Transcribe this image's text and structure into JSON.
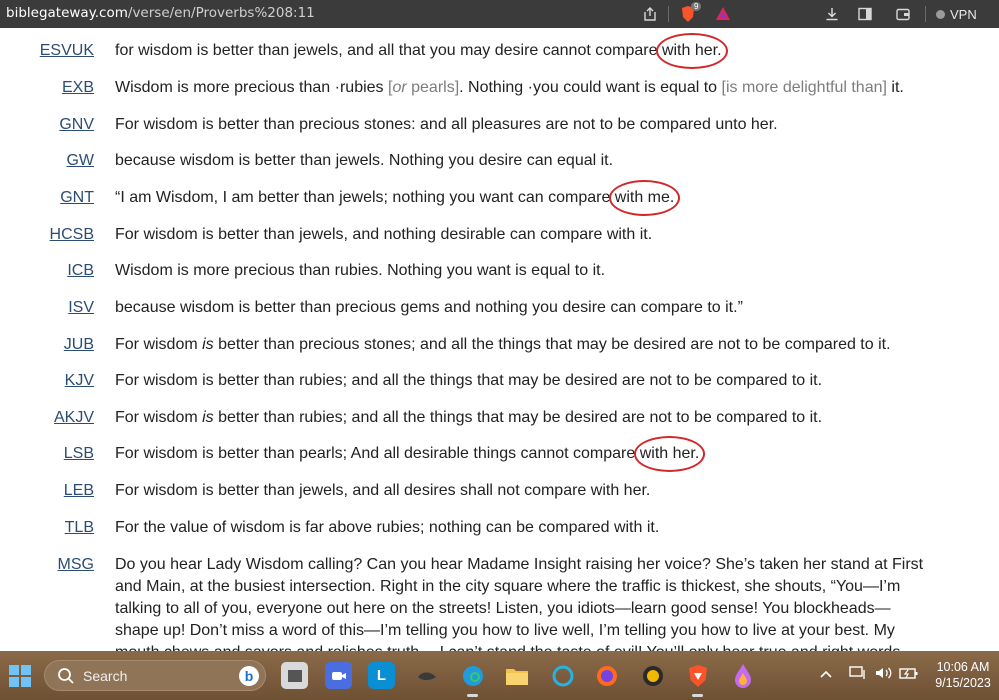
{
  "browser": {
    "url_host": "biblegateway.com",
    "url_path": "/verse/en/Proverbs%208:11",
    "vpn_label": "VPN",
    "brave_badge": "9",
    "icons": [
      "share-icon",
      "brave-shields-icon",
      "brave-rewards-icon",
      "download-icon",
      "sidebar-icon",
      "wallet-icon"
    ]
  },
  "verses": [
    {
      "abbr": "ESVUK",
      "pre": "for wisdom is better than jewels, and all that you may desire cannot compare ",
      "circled": "with her.",
      "post": ""
    },
    {
      "abbr": "EXB",
      "text_parts": [
        {
          "t": "Wisdom is more precious than ·rubies "
        },
        {
          "t": "[or pearls]",
          "note": true,
          "em": "or"
        },
        {
          "t": ". Nothing ·you could want is equal to "
        },
        {
          "t": "[is more delightful than]",
          "note": true
        },
        {
          "t": " it."
        }
      ]
    },
    {
      "abbr": "GNV",
      "text": "For wisdom is better than precious stones: and all pleasures are not to be compared unto her."
    },
    {
      "abbr": "GW",
      "text": "because wisdom is better than jewels. Nothing you desire can equal it."
    },
    {
      "abbr": "GNT",
      "pre": "“I am Wisdom, I am better than jewels; nothing you want can compare ",
      "circled": "with me.",
      "post": ""
    },
    {
      "abbr": "HCSB",
      "text": "For wisdom is better than jewels, and nothing desirable can compare with it."
    },
    {
      "abbr": "ICB",
      "text": "Wisdom is more precious than rubies. Nothing you want is equal to it."
    },
    {
      "abbr": "ISV",
      "text": "because wisdom is better than precious gems and nothing you desire can compare to it.”"
    },
    {
      "abbr": "JUB",
      "pre": "For wisdom ",
      "italic": "is",
      "post": " better than precious stones; and all the things that may be desired are not to be compared to it."
    },
    {
      "abbr": "KJV",
      "text": "For wisdom is better than rubies; and all the things that may be desired are not to be compared to it."
    },
    {
      "abbr": "AKJV",
      "pre": "For wisdom ",
      "italic": "is",
      "post": " better than rubies; and all the things that may be desired are not to be compared to it."
    },
    {
      "abbr": "LSB",
      "pre": "For wisdom is better than pearls; And all desirable things cannot compare ",
      "circled": "with her.",
      "post": ""
    },
    {
      "abbr": "LEB",
      "text": "For wisdom is better than jewels, and all desires shall not compare with her."
    },
    {
      "abbr": "TLB",
      "text": "For the value of wisdom is far above rubies; nothing can be compared with it."
    },
    {
      "abbr": "MSG",
      "text": "Do you hear Lady Wisdom calling? Can you hear Madame Insight raising her voice? She’s taken her stand at First and Main, at the busiest intersection. Right in the city square where the traffic is thickest, she shouts, “You—I’m talking to all of you, everyone out here on the streets! Listen, you idiots—learn good sense! You blockheads—shape up! Don’t miss a word of this—I’m telling you how to live well, I’m telling you how to live at your best. My mouth chews and savors and relishes truth— I can’t stand the taste of evil! You’ll only hear true and right words"
    }
  ],
  "taskbar": {
    "search_label": "Search",
    "bing_letter": "b",
    "tray_up": "^",
    "time": "10:06 AM",
    "date": "9/15/2023",
    "apps": [
      "file-explorer-icon",
      "zoom-icon",
      "l-app-icon",
      "gecko-icon",
      "edge-icon",
      "folder-icon",
      "cortana-icon",
      "firefox-icon",
      "game-icon",
      "brave-icon",
      "chrome-canary-icon"
    ],
    "accent": "#d3282a"
  }
}
